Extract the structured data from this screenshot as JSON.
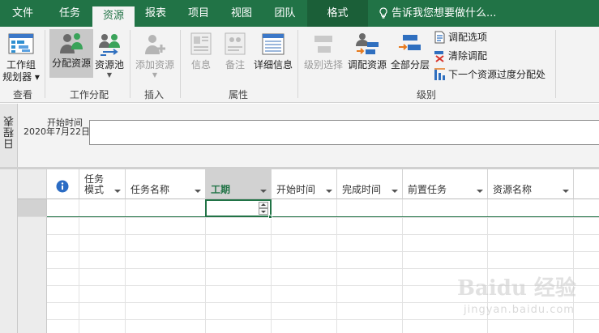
{
  "tabs": [
    "文件",
    "任务",
    "资源",
    "报表",
    "项目",
    "视图",
    "团队",
    "格式"
  ],
  "tell_me": "告诉我您想要做什么...",
  "ribbon": {
    "view_group": {
      "label": "查看",
      "team_planner": "工作组\n规划器 ▾"
    },
    "assign_group": {
      "label": "工作分配",
      "assign_resources": "分配资源",
      "resource_pool": "资源池"
    },
    "insert_group": {
      "label": "插入",
      "add_resources": "添加资源"
    },
    "properties_group": {
      "label": "属性",
      "information": "信息",
      "notes": "备注",
      "details": "详细信息"
    },
    "level_group": {
      "label": "级别",
      "level_selection": "级别选择",
      "level_resource": "调配资源",
      "level_all": "全部分层",
      "leveling_options": "调配选项",
      "clear_leveling": "清除调配",
      "next_overallocation": "下一个资源过度分配处"
    }
  },
  "timeline": {
    "side_label": "日程表",
    "start_label": "开始时间",
    "start_date": "2020年7月22日"
  },
  "grid": {
    "columns": [
      {
        "key": "info",
        "label": ""
      },
      {
        "key": "mode",
        "label": "任务\n模式"
      },
      {
        "key": "name",
        "label": "任务名称"
      },
      {
        "key": "duration",
        "label": "工期"
      },
      {
        "key": "start",
        "label": "开始时间"
      },
      {
        "key": "finish",
        "label": "完成时间"
      },
      {
        "key": "predecessors",
        "label": "前置任务"
      },
      {
        "key": "resource_names",
        "label": "资源名称"
      }
    ],
    "selected_column": "工期"
  },
  "watermark": {
    "line1": "Baidu 经验",
    "line2": "jingyan.baidu.com"
  },
  "colors": {
    "accent": "#217346",
    "ribbon_bg": "#f3f3f3",
    "header_selected": "#d2d2d2"
  }
}
